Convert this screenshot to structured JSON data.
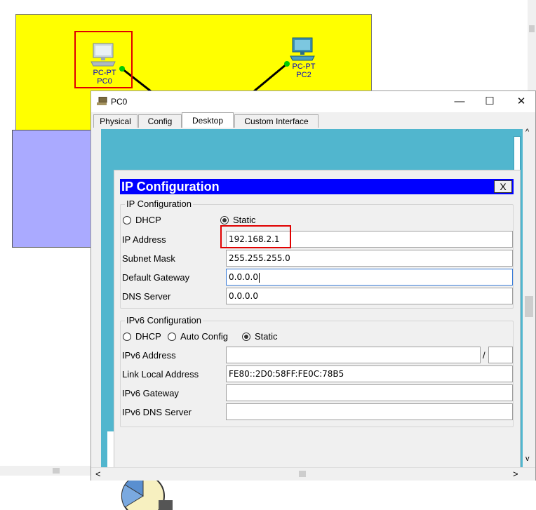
{
  "workspace": {
    "pc0": {
      "type_label": "PC-PT",
      "name_label": "PC0"
    },
    "pc2": {
      "type_label": "PC-PT",
      "name_label": "PC2"
    },
    "colors": {
      "zone_yellow": "#ffff00",
      "zone_blue": "#aaaaff",
      "link_dot": "#00cc00",
      "highlight": "#e00000"
    }
  },
  "window": {
    "title": "PC0",
    "controls": {
      "minimize": "—",
      "maximize": "☐",
      "close": "✕"
    },
    "tabs": [
      "Physical",
      "Config",
      "Desktop",
      "Custom Interface"
    ],
    "active_tab": "Desktop"
  },
  "ip_dialog": {
    "title": "IP Configuration",
    "close_label": "X",
    "ipv4_group_title": "IP Configuration",
    "dhcp_label": "DHCP",
    "static_label": "Static",
    "mode": "Static",
    "ip_address_label": "IP Address",
    "ip_address": "192.168.2.1",
    "subnet_mask_label": "Subnet Mask",
    "subnet_mask": "255.255.255.0",
    "default_gateway_label": "Default Gateway",
    "default_gateway": "0.0.0.0",
    "dns_server_label": "DNS Server",
    "dns_server": "0.0.0.0",
    "ipv6_group_title": "IPv6 Configuration",
    "ipv6_dhcp_label": "DHCP",
    "ipv6_auto_label": "Auto Config",
    "ipv6_static_label": "Static",
    "ipv6_mode": "Static",
    "ipv6_address_label": "IPv6 Address",
    "ipv6_address": "",
    "ipv6_prefix_sep": "/",
    "ipv6_prefix": "",
    "link_local_label": "Link Local Address",
    "link_local": "FE80::2D0:58FF:FE0C:78B5",
    "ipv6_gateway_label": "IPv6 Gateway",
    "ipv6_gateway": "",
    "ipv6_dns_label": "IPv6 DNS Server",
    "ipv6_dns": ""
  },
  "scrollbar": {
    "left_arrow": "<",
    "right_arrow": ">",
    "up_arrow": "^",
    "down_arrow": "v"
  }
}
